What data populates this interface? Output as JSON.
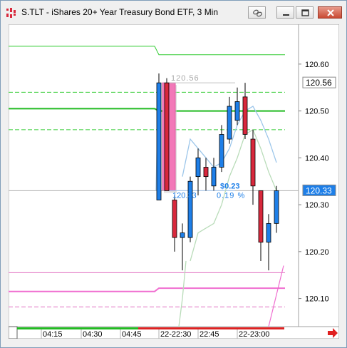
{
  "window": {
    "title": "S.TLT - iShares 20+ Year Treasury Bond ETF, 3 Min",
    "buttons": [
      "link-icon",
      "minimize-icon",
      "maximize-icon",
      "close-icon"
    ]
  },
  "chart_data": {
    "type": "candlestick",
    "symbol": "S.TLT",
    "interval": "3 Min",
    "y_axis": {
      "range": [
        120.04,
        120.685
      ],
      "ticks": [
        "120.60",
        "120.50",
        "120.40",
        "120.30",
        "120.20",
        "120.10"
      ]
    },
    "x_axis": {
      "ticks": [
        "04:15",
        "04:30",
        "04:45",
        "22-22:30",
        "22:45",
        "22-23:00"
      ]
    },
    "price_markers": [
      {
        "label": "120.56",
        "value": 120.56,
        "color": "#ffffff",
        "text_color": "#000000"
      },
      {
        "label": "120.33",
        "value": 120.33,
        "color": "#1e7fe8",
        "text_color": "#ffffff"
      }
    ],
    "candles": [
      {
        "open": 120.31,
        "high": 120.58,
        "low": 120.31,
        "close": 120.56
      },
      {
        "open": 120.56,
        "high": 120.57,
        "low": 120.33,
        "close": 120.33
      },
      {
        "open": 120.31,
        "high": 120.32,
        "low": 120.2,
        "close": 120.23
      },
      {
        "open": 120.23,
        "high": 120.26,
        "low": 120.16,
        "close": 120.24
      },
      {
        "open": 120.23,
        "high": 120.36,
        "low": 120.22,
        "close": 120.35
      },
      {
        "open": 120.36,
        "high": 120.42,
        "low": 120.32,
        "close": 120.4
      },
      {
        "open": 120.38,
        "high": 120.4,
        "low": 120.33,
        "close": 120.36
      },
      {
        "open": 120.34,
        "high": 120.4,
        "low": 120.33,
        "close": 120.38
      },
      {
        "open": 120.38,
        "high": 120.47,
        "low": 120.37,
        "close": 120.45
      },
      {
        "open": 120.44,
        "high": 120.53,
        "low": 120.43,
        "close": 120.51
      },
      {
        "open": 120.48,
        "high": 120.55,
        "low": 120.47,
        "close": 120.52
      },
      {
        "open": 120.53,
        "high": 120.56,
        "low": 120.44,
        "close": 120.45
      },
      {
        "open": 120.44,
        "high": 120.46,
        "low": 120.3,
        "close": 120.34
      },
      {
        "open": 120.33,
        "high": 120.33,
        "low": 120.18,
        "close": 120.22
      },
      {
        "open": 120.22,
        "high": 120.28,
        "low": 120.16,
        "close": 120.26
      },
      {
        "open": 120.26,
        "high": 120.34,
        "low": 120.24,
        "close": 120.33
      }
    ],
    "colors": {
      "up": "#1e7fe8",
      "down": "#d8283c",
      "outline": "#000000"
    },
    "levels": [
      {
        "value": 120.62,
        "color": "#33cc33",
        "style": "solid",
        "pre": 120.638
      },
      {
        "value": 120.54,
        "color": "#33cc33",
        "style": "dashed"
      },
      {
        "value": 120.5,
        "color": "#22bb22",
        "style": "solid",
        "width": 2,
        "pre": 120.505
      },
      {
        "value": 120.46,
        "color": "#33cc33",
        "style": "dashed"
      },
      {
        "value": 120.155,
        "color": "#e070c0",
        "style": "solid"
      },
      {
        "value": 120.122,
        "color": "#f06ed0",
        "style": "solid",
        "width": 2,
        "pre": 120.115
      },
      {
        "value": 120.082,
        "color": "#e070c0",
        "style": "dashed"
      }
    ],
    "ma_blue": [
      120.36,
      120.44,
      120.42,
      120.4,
      120.38,
      120.39,
      120.42,
      120.47,
      120.5,
      120.51,
      120.48,
      120.44,
      120.39
    ],
    "ma_green": [
      120.18,
      120.24,
      120.25,
      120.26,
      120.3,
      120.36,
      120.4,
      120.45,
      120.46,
      120.42,
      120.37,
      120.33
    ],
    "annotations": {
      "high_label": "120.56",
      "low_label": "120.33",
      "change": "$0.23",
      "change_pct": "0.19 %"
    }
  }
}
